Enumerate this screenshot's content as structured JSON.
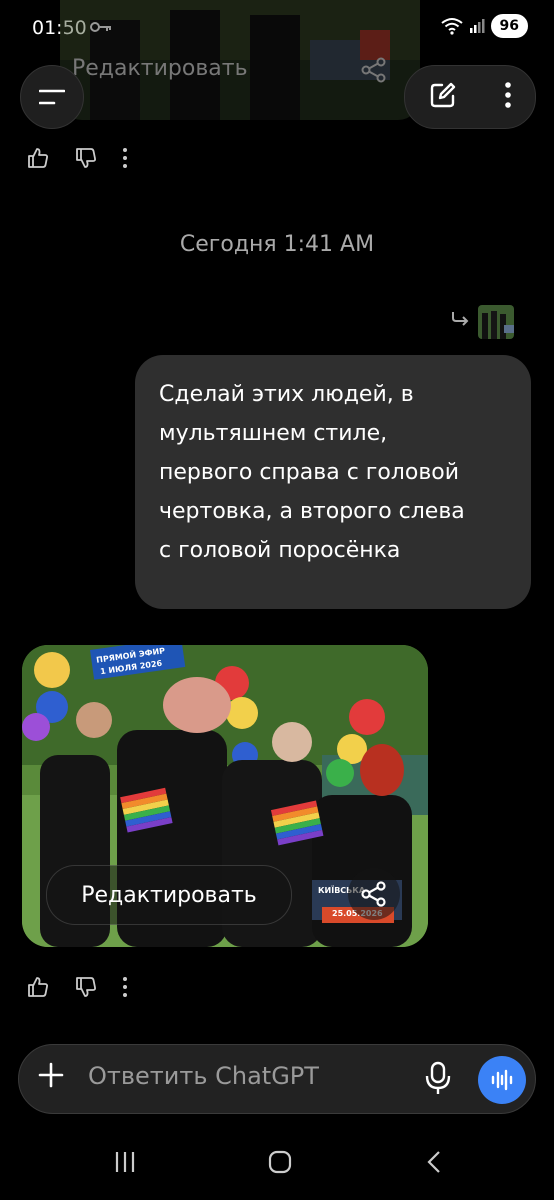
{
  "status_bar": {
    "time": "01:50",
    "battery": "96"
  },
  "top_message": {
    "edit_label": "Редактировать"
  },
  "date_separator": "Сегодня 1:41 AM",
  "user_message": {
    "lines": [
      "Сделай этих людей, в",
      "мультяшнем стиле,",
      "первого справа с головой",
      "чертовка, а второго слева",
      "с головой поросёнка"
    ]
  },
  "generated_image": {
    "banner_line1": "ПРЯМОЙ ЭФИР",
    "banner_line2": "1 ИЮЛЯ 2026",
    "sign_line1": "КИЇВСЬКА",
    "sign_line2": "25.05.2026",
    "edit_label": "Редактировать"
  },
  "composer": {
    "placeholder": "Ответить ChatGPT"
  },
  "colors": {
    "bubble": "#2f2f2f",
    "voice_button": "#3b82f6",
    "background": "#000000"
  }
}
